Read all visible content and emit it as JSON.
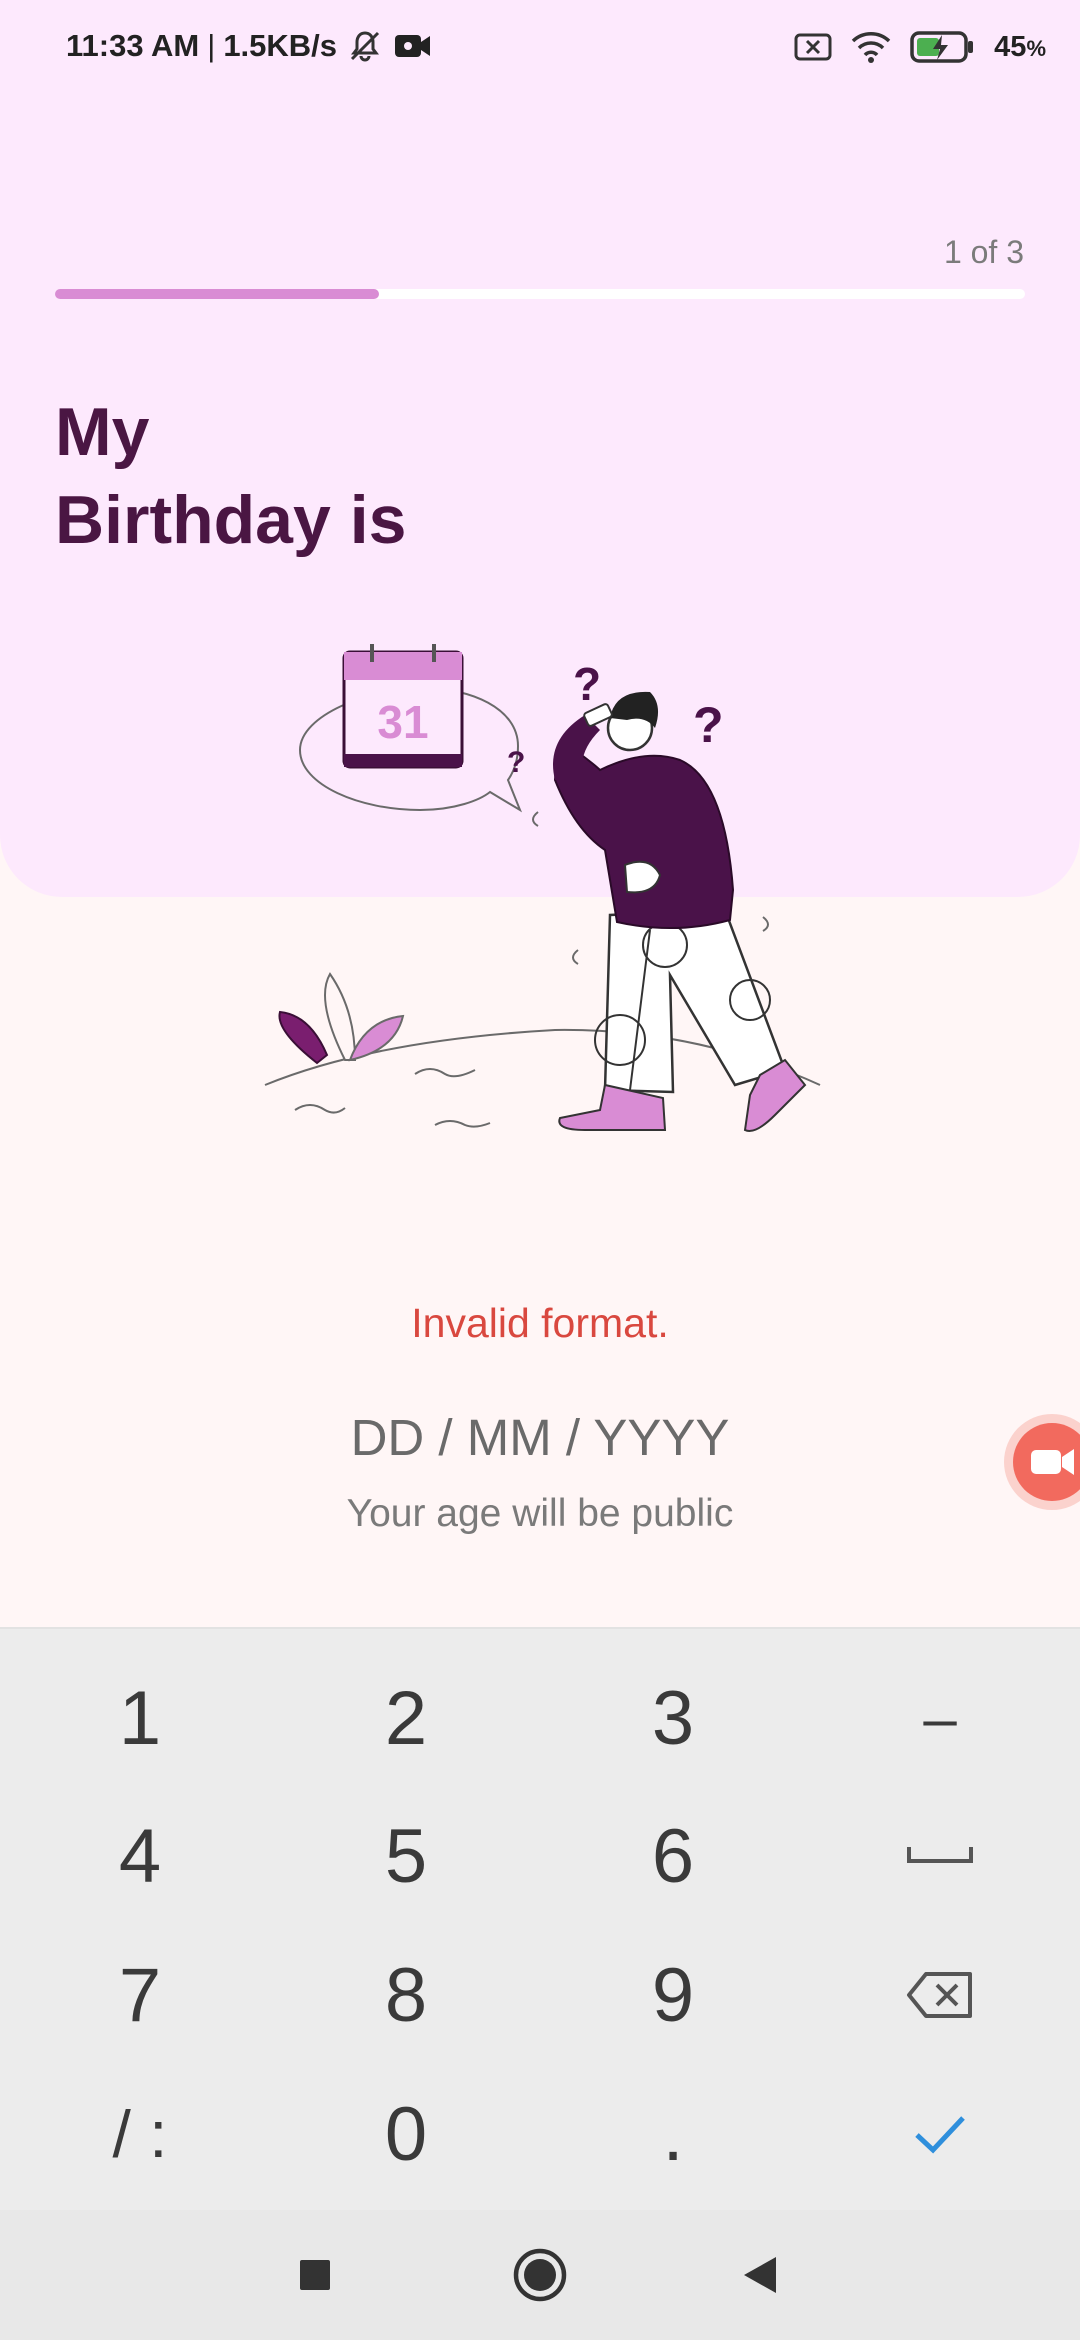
{
  "status_bar": {
    "time": "11:33 AM",
    "separator": "|",
    "network_speed": "1.5KB/s",
    "battery_percent": "45",
    "battery_unit": "%",
    "icons": [
      "mute-icon",
      "video-record-icon",
      "no-sim-icon",
      "wifi-icon",
      "battery-charging-icon"
    ]
  },
  "progress": {
    "counter_text": "1 of 3",
    "fraction": 0.334,
    "fill_color": "#d98cd4",
    "track_color": "#ffffff"
  },
  "header": {
    "title_line1": "My",
    "title_line2": "Birthday is"
  },
  "illustration": {
    "calendar_day": "31",
    "question_marks": [
      "?",
      "?",
      "?"
    ]
  },
  "form": {
    "error": "Invalid format.",
    "date_placeholder": "DD / MM / YYYY",
    "date_value": "",
    "helper": "Your age will be public"
  },
  "keyboard": {
    "rows": [
      [
        "1",
        "2",
        "3",
        "–"
      ],
      [
        "4",
        "5",
        "6",
        "space"
      ],
      [
        "7",
        "8",
        "9",
        "backspace"
      ],
      [
        "/ :",
        "0",
        ".",
        "done"
      ]
    ],
    "done_color": "#2f8fdc"
  },
  "nav_bar": {
    "buttons": [
      "recents-icon",
      "home-icon",
      "back-icon"
    ]
  },
  "colors": {
    "panel_background": "#fde9fd",
    "page_background": "#fff6f6",
    "title_color": "#4a1643",
    "error_color": "#d9483f",
    "accent_purple": "#4a1249",
    "accent_pink": "#d98cd4"
  }
}
